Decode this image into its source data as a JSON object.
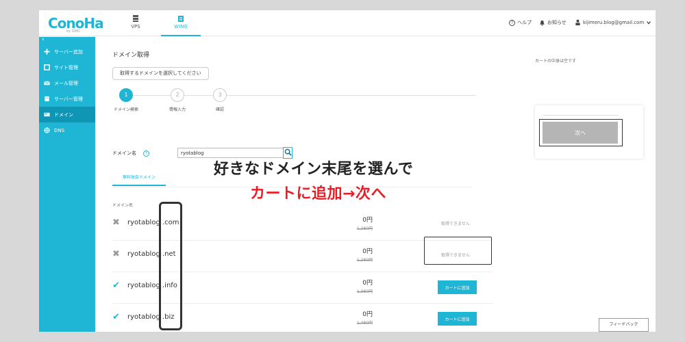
{
  "brand": {
    "logo": "ConoHa",
    "logo_sub": "by GMO",
    "accent": "#1fb6d6"
  },
  "header": {
    "nav": [
      {
        "label": "VPS",
        "icon": "server-icon"
      },
      {
        "label": "WING",
        "icon": "building-icon"
      }
    ],
    "help": "ヘルプ",
    "notice": "お知らせ",
    "account": "kijimeru.blog@gmail.com"
  },
  "sidebar": {
    "items": [
      {
        "label": "サーバー追加",
        "icon": "plus-icon"
      },
      {
        "label": "サイト管理",
        "icon": "window-icon"
      },
      {
        "label": "メール管理",
        "icon": "envelope-icon"
      },
      {
        "label": "サーバー管理",
        "icon": "building-icon"
      },
      {
        "label": "ドメイン",
        "icon": "card-icon"
      },
      {
        "label": "DNS",
        "icon": "globe-icon"
      }
    ]
  },
  "main": {
    "title": "ドメイン取得",
    "hint": "取得するドメインを選択してください",
    "steps": [
      {
        "num": "1",
        "label": "ドメイン検索"
      },
      {
        "num": "2",
        "label": "情報入力"
      },
      {
        "num": "3",
        "label": "確認"
      }
    ],
    "domain_label": "ドメイン名",
    "domain_value": "ryotablog",
    "tab": "無料独自ドメイン",
    "col_header": "ドメイン名",
    "rows": [
      {
        "base": "ryotablog",
        "ext": ".com",
        "price": "0円",
        "orig": "1,280円",
        "available": false,
        "status": "取得できません"
      },
      {
        "base": "ryotablog",
        "ext": ".net",
        "price": "0円",
        "orig": "1,280円",
        "available": false,
        "status": "取得できません"
      },
      {
        "base": "ryotablog",
        "ext": ".info",
        "price": "0円",
        "orig": "1,380円",
        "available": true,
        "status": "カートに追加"
      },
      {
        "base": "ryotablog",
        "ext": ".biz",
        "price": "0円",
        "orig": "1,480円",
        "available": true,
        "status": "カートに追加"
      }
    ]
  },
  "cart": {
    "empty_text": "カートの中身は空です",
    "next_label": "次へ"
  },
  "feedback": "フィードバック",
  "caption": {
    "line1": "好きなドメイン末尾を選んで",
    "line2": "カートに追加→次へ",
    "line2_color": "#ec1c24"
  }
}
